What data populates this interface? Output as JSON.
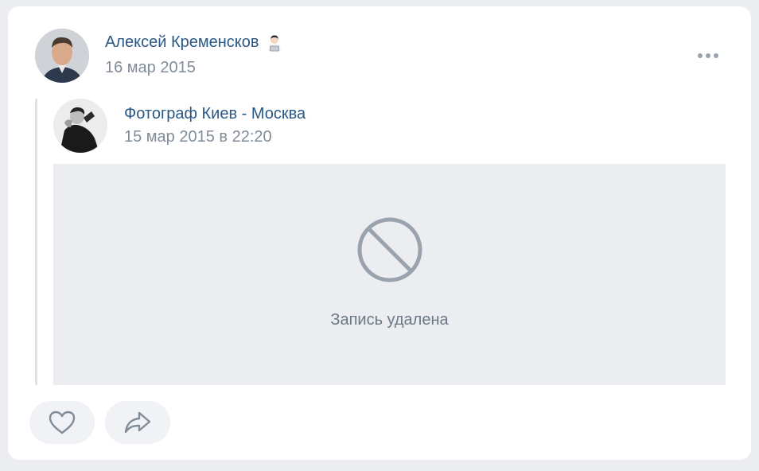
{
  "post": {
    "author_name": "Алексей Кременсков",
    "author_emoji": "technologist-emoji-icon",
    "date": "16 мар 2015",
    "menu_icon": "more-dots-icon"
  },
  "repost": {
    "author_name": "Фотограф Киев - Москва",
    "date": "15 мар 2015 в 22:20",
    "deleted_icon": "ban-icon",
    "deleted_text": "Запись удалена"
  },
  "actions": {
    "like_icon": "heart-icon",
    "share_icon": "share-arrow-icon"
  },
  "colors": {
    "link": "#2a5885",
    "secondary": "#818c99",
    "placeholder_bg": "#ebedf0",
    "icon": "#99a2ad"
  }
}
